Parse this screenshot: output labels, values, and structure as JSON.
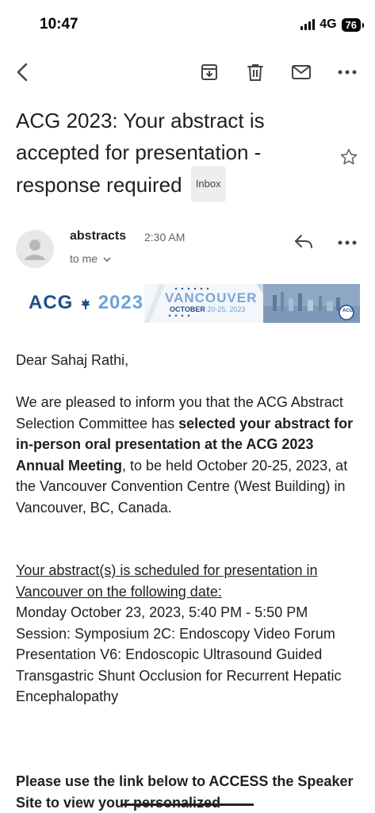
{
  "status_bar": {
    "time": "10:47",
    "network": "4G",
    "battery": "76"
  },
  "email": {
    "subject": "ACG 2023: Your abstract is accepted for presentation - response required",
    "label": "Inbox",
    "sender": "abstracts",
    "time": "2:30 AM",
    "recipient": "to me"
  },
  "banner": {
    "logo_text": "ACG",
    "logo_year": "2023",
    "city": "VANCOUVER",
    "month": "OCTOBER",
    "dates": "20-25, 2023",
    "badge": "ACG"
  },
  "body": {
    "greeting": "Dear Sahaj Rathi,",
    "p1_part1": "We are pleased to inform you that the ACG Abstract Selection Committee has ",
    "p1_bold": "selected your abstract for in-person oral presentation at the ACG 2023 Annual Meeting",
    "p1_part2": ", to be held October 20-25, 2023, at the Vancouver Convention Centre (West Building) in Vancouver, BC, Canada.",
    "schedule_heading": "Your abstract(s) is scheduled for presentation in Vancouver on the following date:",
    "schedule_date": "Monday October 23, 2023, 5:40 PM - 5:50 PM",
    "session": "Session: Symposium 2C: Endoscopy Video Forum",
    "presentation": "Presentation V6: Endoscopic Ultrasound Guided Transgastric Shunt Occlusion for Recurrent Hepatic Encephalopathy",
    "access_text": "Please use the link below to ACCESS the Speaker Site to view your personalized"
  },
  "icons": [
    "back-arrow-icon",
    "archive-icon",
    "trash-icon",
    "mail-icon",
    "more-vert-icon",
    "star-icon",
    "reply-icon"
  ]
}
